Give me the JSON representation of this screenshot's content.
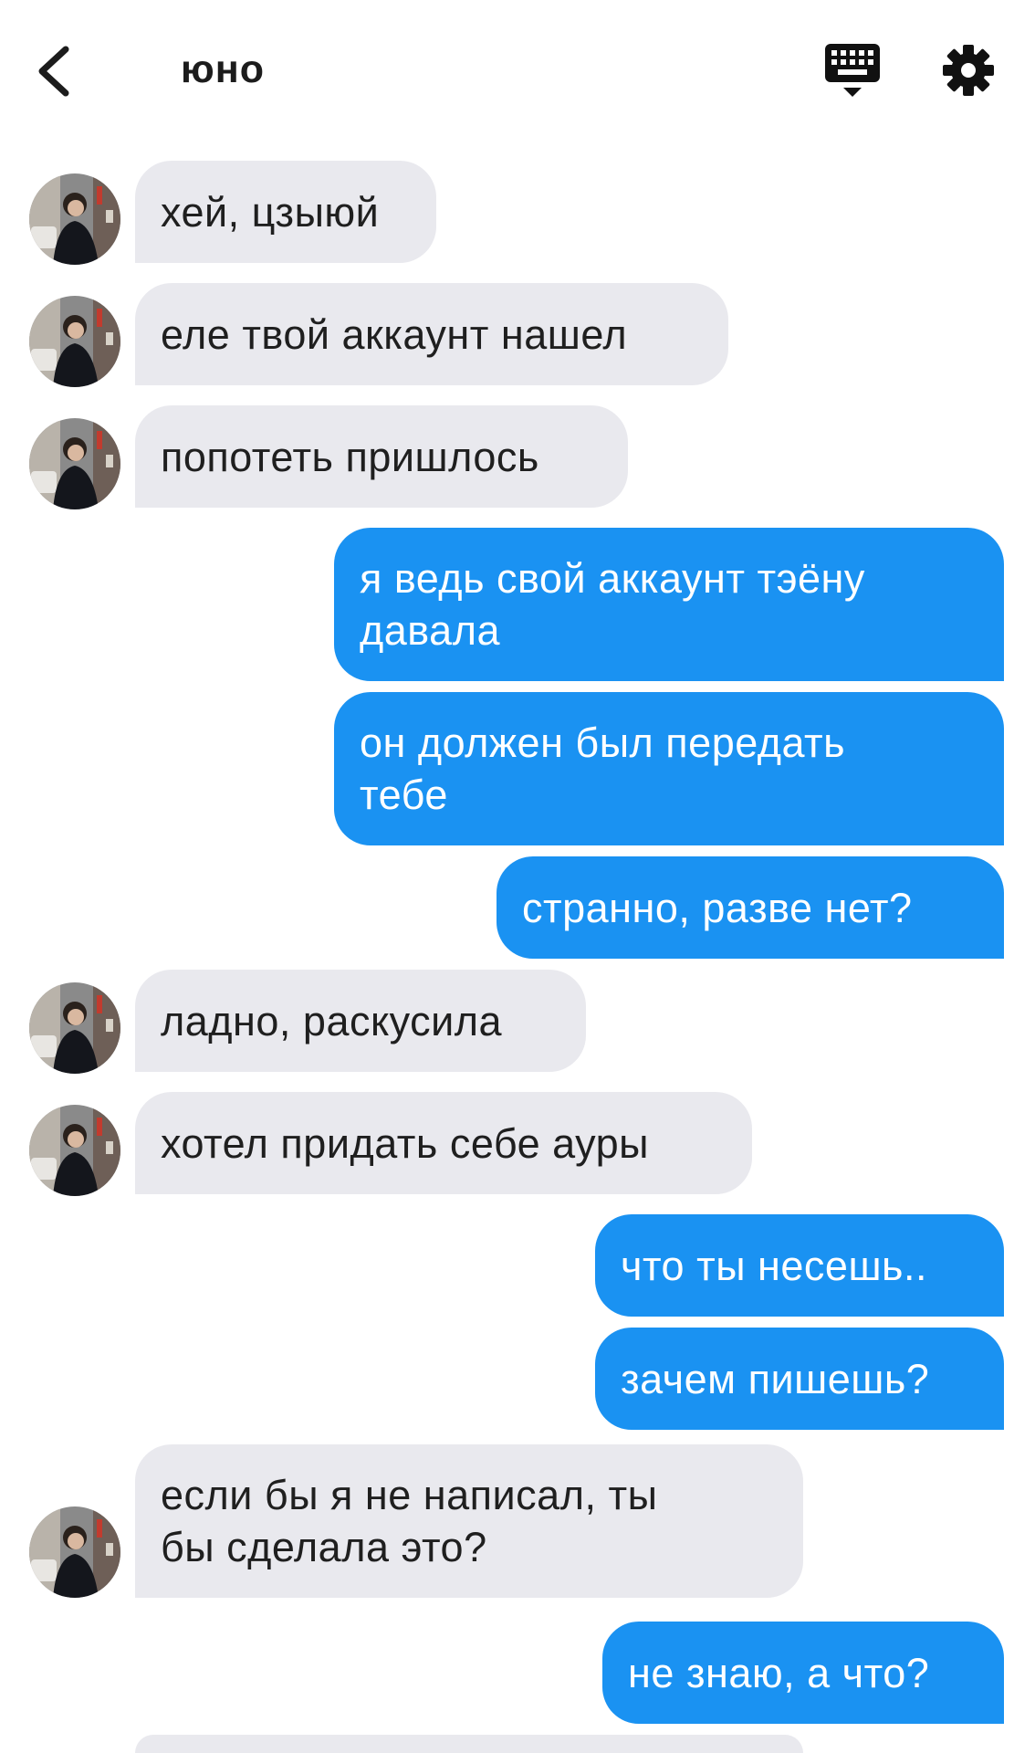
{
  "header": {
    "back_icon": "chevron-left-icon",
    "title": "юно",
    "keyboard_icon": "keyboard-icon",
    "settings_icon": "gear-icon"
  },
  "colors": {
    "incoming_bubble": "#e9e9ee",
    "outgoing_bubble": "#1a92f2",
    "outgoing_text": "#ffffff",
    "incoming_text": "#1f1f1f"
  },
  "messages": [
    {
      "dir": "in",
      "text": "хей, цзыюй"
    },
    {
      "dir": "in",
      "text": "еле твой аккаунт нашел"
    },
    {
      "dir": "in",
      "text": "попотеть пришлось"
    },
    {
      "dir": "out",
      "text": "я ведь свой аккаунт тэёну\nдавала"
    },
    {
      "dir": "out",
      "text": "он должен был передать\nтебе"
    },
    {
      "dir": "out",
      "text": "странно, разве нет?"
    },
    {
      "dir": "in",
      "text": "ладно, раскусила"
    },
    {
      "dir": "in",
      "text": "хотел придать себе ауры"
    },
    {
      "dir": "out",
      "text": "что ты несешь.."
    },
    {
      "dir": "out",
      "text": "зачем пишешь?"
    },
    {
      "dir": "in",
      "text": "если бы я не написал, ты\nбы сделала это?"
    },
    {
      "dir": "out",
      "text": "не знаю, а что?"
    },
    {
      "dir": "in",
      "text": ""
    }
  ]
}
